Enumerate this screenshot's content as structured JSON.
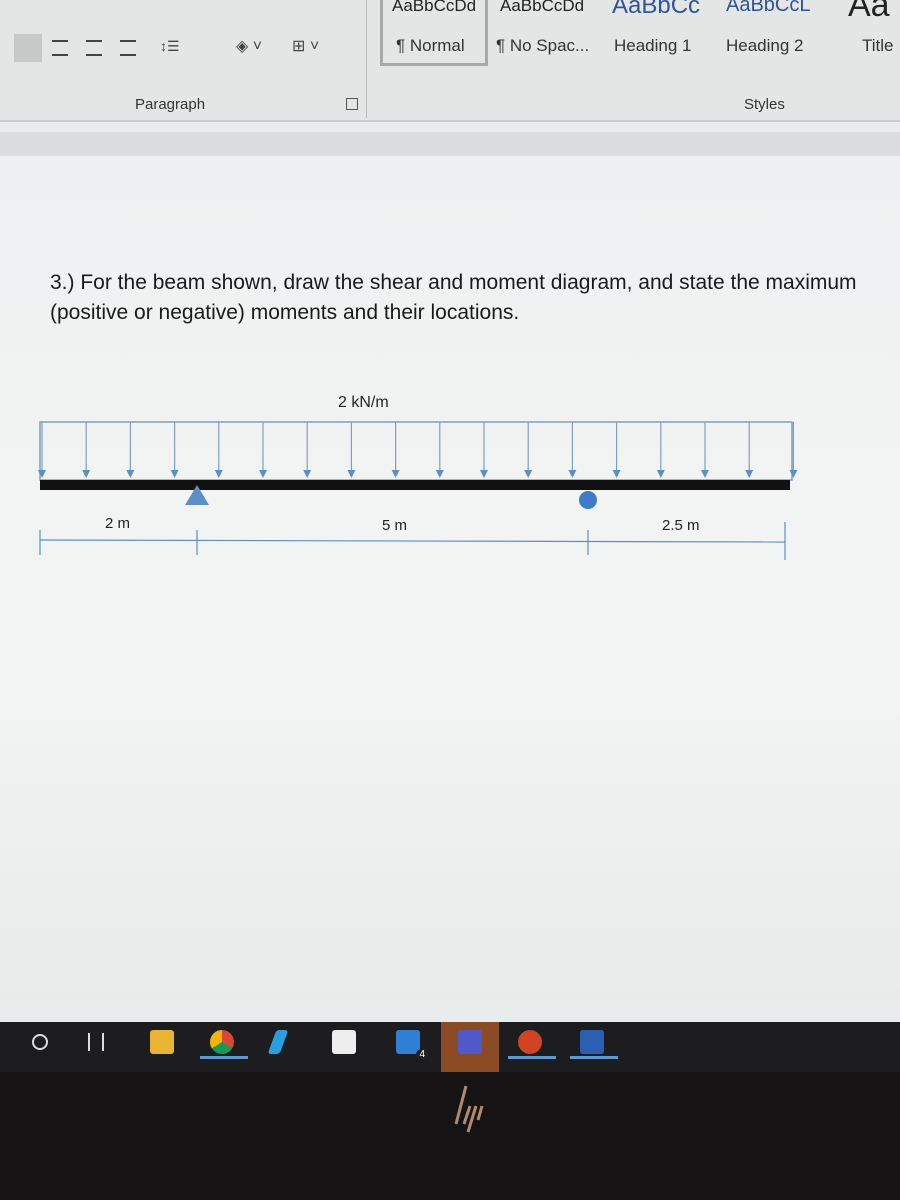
{
  "ribbon": {
    "styles": [
      {
        "sample": "AaBbCcDd",
        "name": "¶ Normal"
      },
      {
        "sample": "AaBbCcDd",
        "name": "¶ No Spac..."
      },
      {
        "sample": "AaBbCc",
        "name": "Heading 1"
      },
      {
        "sample": "AaBbCcL",
        "name": "Heading 2"
      },
      {
        "sample": "Aa",
        "name": "Title"
      }
    ],
    "groups": {
      "paragraph": "Paragraph",
      "styles": "Styles"
    }
  },
  "document": {
    "question": "3.) For the beam shown, draw the shear and moment diagram, and state the maximum (positive or negative) moments and their locations.",
    "figure": {
      "load_label": "2 kN/m",
      "dimensions": [
        "2 m",
        "5 m",
        "2.5 m"
      ],
      "supports": [
        "pin",
        "roller"
      ]
    }
  },
  "taskbar": {
    "icons": [
      "cortana-icon",
      "task-view-icon",
      "file-explorer-icon",
      "chrome-icon",
      "app-icon",
      "store-icon",
      "mail-icon",
      "teams-icon",
      "powerpoint-icon",
      "word-icon"
    ],
    "mail_badge": "4",
    "accent": "#5a9bd5"
  }
}
